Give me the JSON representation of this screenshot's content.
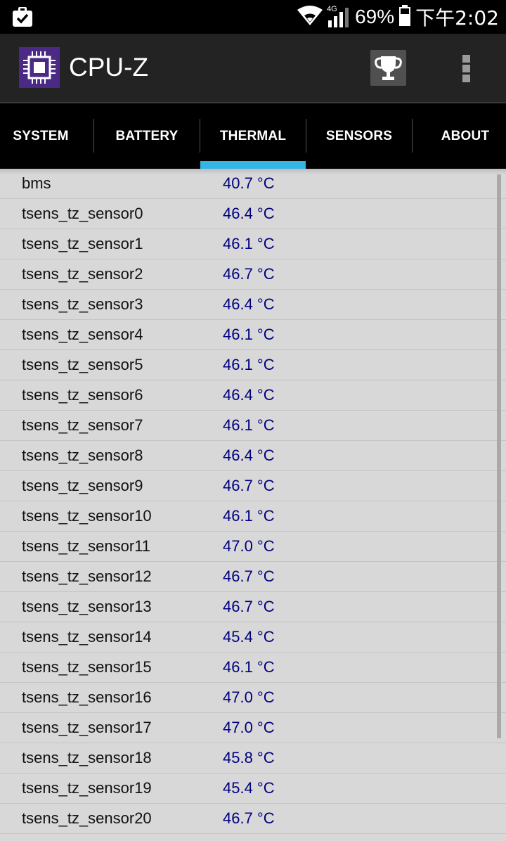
{
  "status_bar": {
    "network_label": "4G",
    "battery_percent": "69%",
    "time": "下午2:02",
    "icons": [
      "clipboard-check-icon",
      "wifi-icon",
      "signal-icon",
      "battery-icon"
    ]
  },
  "app_bar": {
    "title": "CPU-Z",
    "icons": [
      "cpu-chip-icon",
      "trophy-icon",
      "overflow-menu-icon"
    ]
  },
  "tabs": [
    {
      "label": "SYSTEM",
      "active": false
    },
    {
      "label": "BATTERY",
      "active": false
    },
    {
      "label": "THERMAL",
      "active": true
    },
    {
      "label": "SENSORS",
      "active": false
    },
    {
      "label": "ABOUT",
      "active": false
    }
  ],
  "thermal": [
    {
      "name": "bms",
      "value": "40.7 °C"
    },
    {
      "name": "tsens_tz_sensor0",
      "value": "46.4 °C"
    },
    {
      "name": "tsens_tz_sensor1",
      "value": "46.1 °C"
    },
    {
      "name": "tsens_tz_sensor2",
      "value": "46.7 °C"
    },
    {
      "name": "tsens_tz_sensor3",
      "value": "46.4 °C"
    },
    {
      "name": "tsens_tz_sensor4",
      "value": "46.1 °C"
    },
    {
      "name": "tsens_tz_sensor5",
      "value": "46.1 °C"
    },
    {
      "name": "tsens_tz_sensor6",
      "value": "46.4 °C"
    },
    {
      "name": "tsens_tz_sensor7",
      "value": "46.1 °C"
    },
    {
      "name": "tsens_tz_sensor8",
      "value": "46.4 °C"
    },
    {
      "name": "tsens_tz_sensor9",
      "value": "46.7 °C"
    },
    {
      "name": "tsens_tz_sensor10",
      "value": "46.1 °C"
    },
    {
      "name": "tsens_tz_sensor11",
      "value": "47.0 °C"
    },
    {
      "name": "tsens_tz_sensor12",
      "value": "46.7 °C"
    },
    {
      "name": "tsens_tz_sensor13",
      "value": "46.7 °C"
    },
    {
      "name": "tsens_tz_sensor14",
      "value": "45.4 °C"
    },
    {
      "name": "tsens_tz_sensor15",
      "value": "46.1 °C"
    },
    {
      "name": "tsens_tz_sensor16",
      "value": "47.0 °C"
    },
    {
      "name": "tsens_tz_sensor17",
      "value": "47.0 °C"
    },
    {
      "name": "tsens_tz_sensor18",
      "value": "45.8 °C"
    },
    {
      "name": "tsens_tz_sensor19",
      "value": "45.4 °C"
    },
    {
      "name": "tsens_tz_sensor20",
      "value": "46.7 °C"
    }
  ],
  "colors": {
    "accent": "#33b5e5",
    "value_text": "#00007f",
    "list_background": "#d8d8d8",
    "app_icon_background": "#4b2a86"
  }
}
